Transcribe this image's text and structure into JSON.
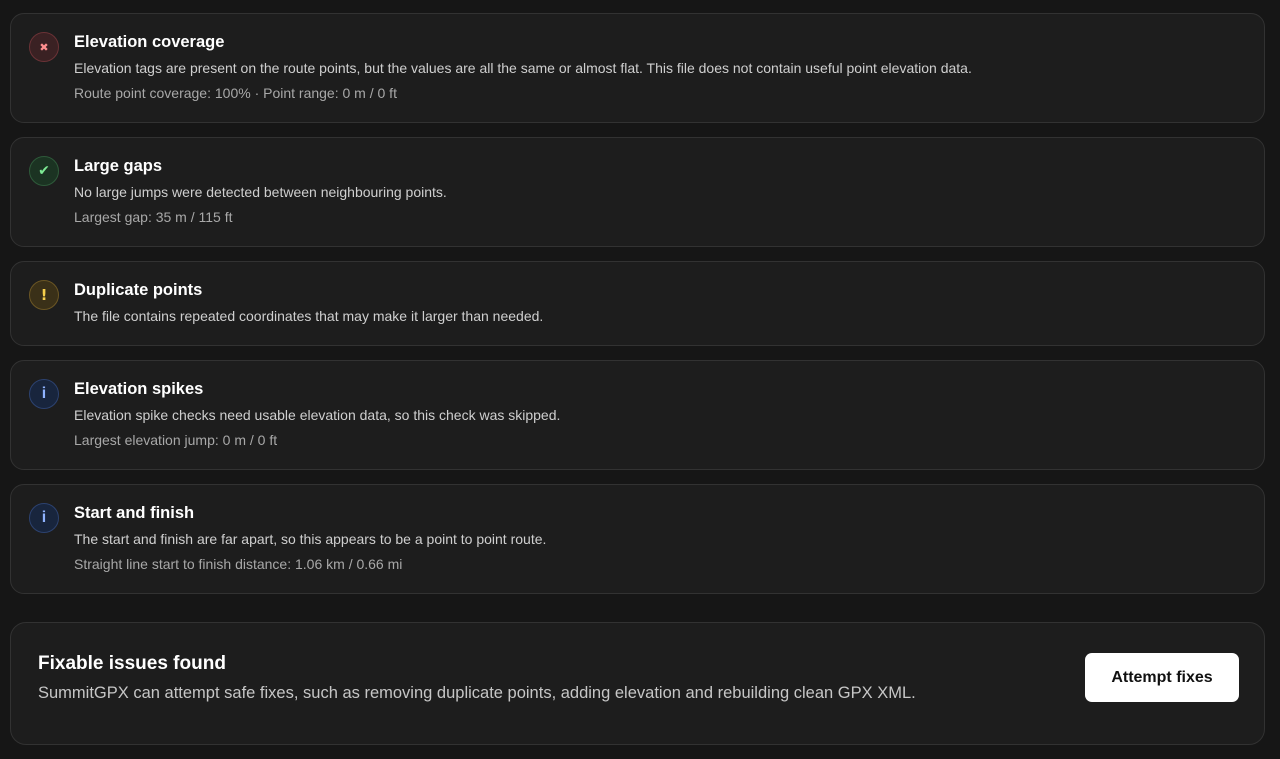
{
  "checks": [
    {
      "status": "error",
      "icon": "x-icon",
      "glyph": "✖",
      "title": "Elevation coverage",
      "description": "Elevation tags are present on the route points, but the values are all the same or almost flat. This file does not contain useful point elevation data.",
      "meta": "Route point coverage: 100% · Point range: 0 m / 0 ft"
    },
    {
      "status": "ok",
      "icon": "checkmark-icon",
      "glyph": "✔",
      "title": "Large gaps",
      "description": "No large jumps were detected between neighbouring points.",
      "meta": "Largest gap: 35 m / 115 ft"
    },
    {
      "status": "warn",
      "icon": "exclamation-icon",
      "glyph": "!",
      "title": "Duplicate points",
      "description": "The file contains repeated coordinates that may make it larger than needed."
    },
    {
      "status": "info",
      "icon": "info-icon",
      "glyph": "i",
      "title": "Elevation spikes",
      "description": "Elevation spike checks need usable elevation data, so this check was skipped.",
      "meta": "Largest elevation jump: 0 m / 0 ft"
    },
    {
      "status": "info",
      "icon": "info-icon",
      "glyph": "i",
      "title": "Start and finish",
      "description": "The start and finish are far apart, so this appears to be a point to point route.",
      "meta": "Straight line start to finish distance: 1.06 km / 0.66 mi"
    }
  ],
  "fix_panel": {
    "title": "Fixable issues found",
    "description": "SummitGPX can attempt safe fixes, such as removing duplicate points, adding elevation and rebuilding clean GPX XML.",
    "button_label": "Attempt fixes"
  },
  "colors": {
    "background": "#161616",
    "card": "#1d1d1d",
    "error": "#ff8f8f",
    "ok": "#7dea94",
    "warn": "#f6cf4c",
    "info": "#8fb3ff"
  }
}
